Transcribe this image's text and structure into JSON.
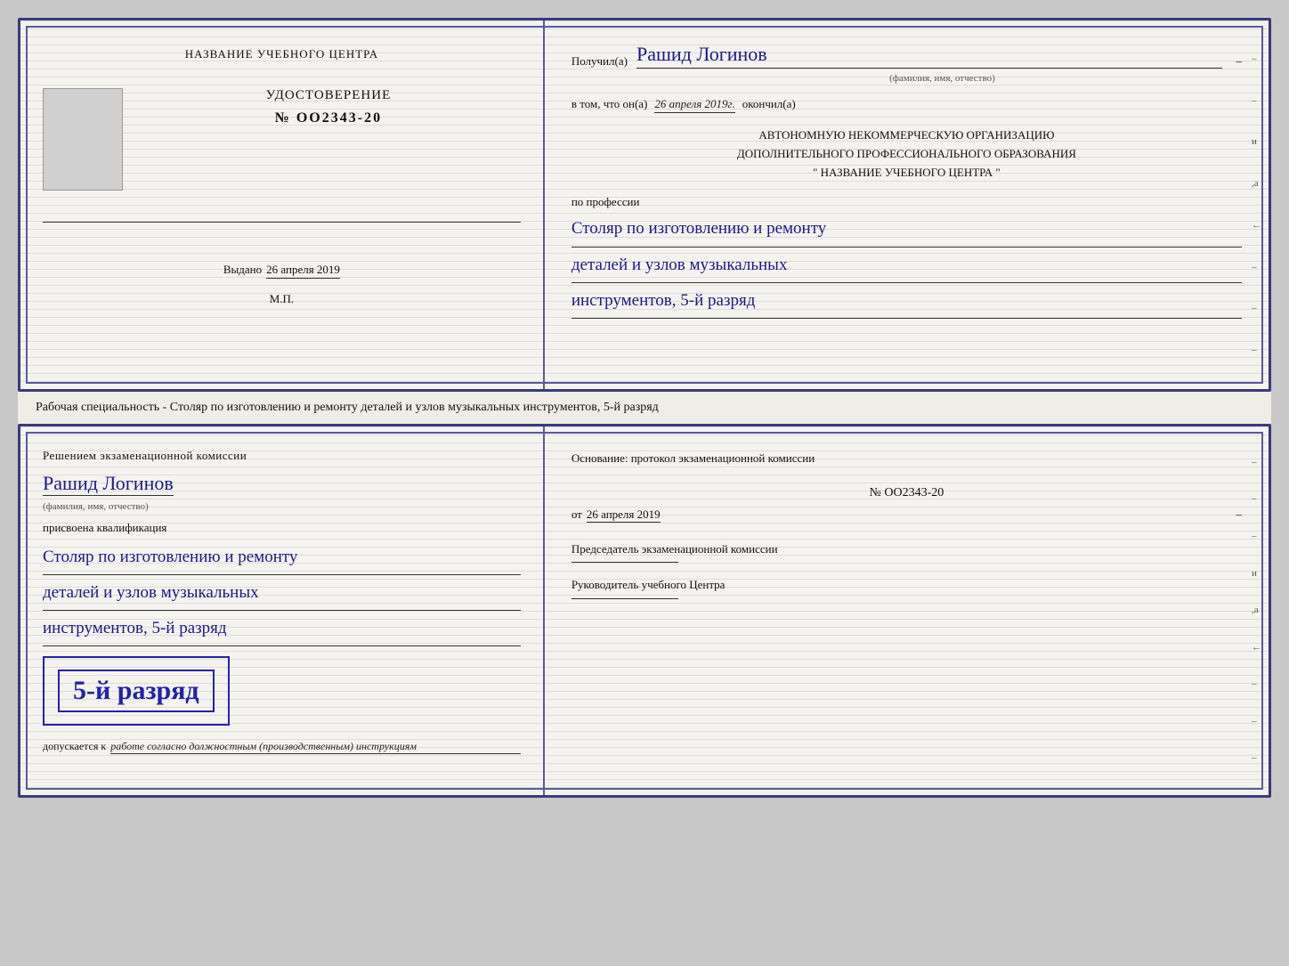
{
  "page": {
    "background_color": "#c8c8c8"
  },
  "top_cert": {
    "left": {
      "header": "НАЗВАНИЕ УЧЕБНОГО ЦЕНТРА",
      "cert_title": "УДОСТОВЕРЕНИЕ",
      "cert_number": "№ OO2343-20",
      "issued_label": "Выдано",
      "issued_date": "26 апреля 2019",
      "mp_label": "М.П."
    },
    "right": {
      "recipient_label": "Получил(а)",
      "recipient_name": "Рашид Логинов",
      "fio_sub": "(фамилия, имя, отчество)",
      "completed_label1": "в том, что он(а)",
      "completed_date": "26 апреля 2019г.",
      "completed_label2": "окончил(а)",
      "org_line1": "АВТОНОМНУЮ НЕКОММЕРЧЕСКУЮ ОРГАНИЗАЦИЮ",
      "org_line2": "ДОПОЛНИТЕЛЬНОГО ПРОФЕССИОНАЛЬНОГО ОБРАЗОВАНИЯ",
      "org_line3": "\"   НАЗВАНИЕ УЧЕБНОГО ЦЕНТРА   \"",
      "profession_label": "по профессии",
      "profession_line1": "Столяр по изготовлению и ремонту",
      "profession_line2": "деталей и узлов музыкальных",
      "profession_line3": "инструментов, 5-й разряд",
      "side_marks": [
        "-",
        "-",
        "и",
        ",а",
        "←",
        "-",
        "-",
        "-"
      ]
    }
  },
  "middle_strip": {
    "text": "Рабочая специальность - Столяр по изготовлению и ремонту деталей и узлов музыкальных инструментов, 5-й разряд"
  },
  "bottom_cert": {
    "left": {
      "decision_text": "Решением экзаменационной комиссии",
      "person_name": "Рашид Логинов",
      "fio_sub": "(фамилия, имя, отчество)",
      "qualification_label": "присвоена квалификация",
      "qual_line1": "Столяр по изготовлению и ремонту",
      "qual_line2": "деталей и узлов музыкальных",
      "qual_line3": "инструментов, 5-й разряд",
      "rank_highlight": "5-й разряд",
      "allowed_label": "допускается к",
      "allowed_text": "работе согласно должностным (производственным) инструкциям"
    },
    "right": {
      "basis_label": "Основание: протокол экзаменационной комиссии",
      "protocol_number": "№  OO2343-20",
      "date_label": "от",
      "date_value": "26 апреля 2019",
      "chairman_label": "Председатель экзаменационной комиссии",
      "director_label": "Руководитель учебного Центра",
      "side_marks": [
        "-",
        "-",
        "-",
        "и",
        ",а",
        "←",
        "-",
        "-",
        "-"
      ]
    }
  }
}
